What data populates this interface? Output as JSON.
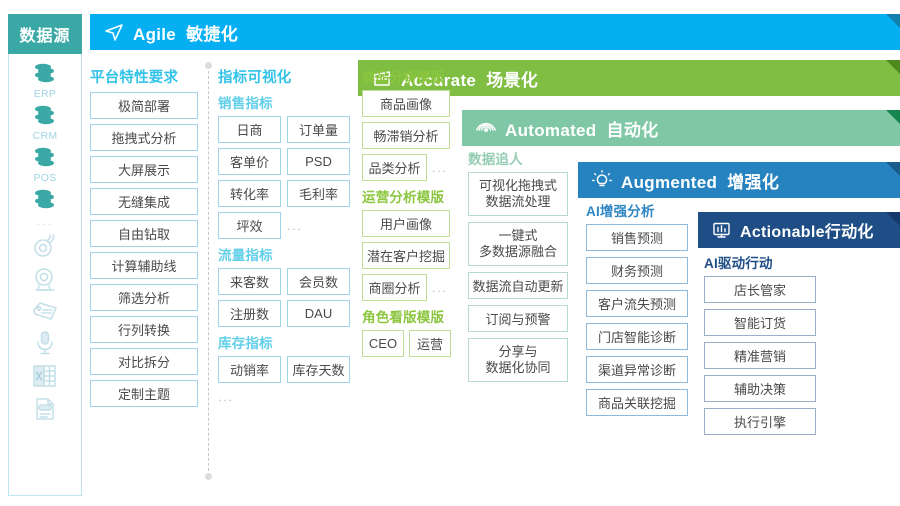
{
  "colors": {
    "agile": "#06aff2",
    "accurate": "#7fbe42",
    "automated": "#80c7a6",
    "augmented": "#2783c0",
    "actionable": "#1f4e87",
    "datasource": "#3aa9a6"
  },
  "datasource": {
    "title": "数据源",
    "items": [
      {
        "icon": "database-icon",
        "label": "ERP"
      },
      {
        "icon": "database-icon",
        "label": "CRM"
      },
      {
        "icon": "database-icon",
        "label": "POS"
      },
      {
        "icon": "database-icon",
        "label": ""
      },
      {
        "icon": "ellipsis",
        "label": "..."
      },
      {
        "icon": "sensor-icon",
        "label": ""
      },
      {
        "icon": "camera-icon",
        "label": ""
      },
      {
        "icon": "rfid-tag-icon",
        "label": ""
      },
      {
        "icon": "microphone-icon",
        "label": ""
      },
      {
        "icon": "excel-file-icon",
        "label": ""
      },
      {
        "icon": "pdf-file-icon",
        "label": ""
      }
    ]
  },
  "banners": {
    "agile": {
      "en": "Agile",
      "cn": "敏捷化",
      "icon": "paper-plane-icon"
    },
    "accurate": {
      "en": "Accurate",
      "cn": "场景化",
      "icon": "clapperboard-icon"
    },
    "automated": {
      "en": "Automated",
      "cn": "自动化",
      "icon": "signal-waves-icon"
    },
    "augmented": {
      "en": "Augmented",
      "cn": "增强化",
      "icon": "lightbulb-icon"
    },
    "actionable": {
      "en": "Actionable",
      "cn": "行动化",
      "icon": "dashboard-chart-icon"
    }
  },
  "platform": {
    "title": "平台特性要求",
    "items": [
      "极简部署",
      "拖拽式分析",
      "大屏展示",
      "无缝集成",
      "自由钻取",
      "计算辅助线",
      "筛选分析",
      "行列转换",
      "对比拆分",
      "定制主题"
    ]
  },
  "metrics": {
    "title": "指标可视化",
    "groups": [
      {
        "title": "销售指标",
        "rows": [
          [
            "日商",
            "订单量"
          ],
          [
            "客单价",
            "PSD"
          ],
          [
            "转化率",
            "毛利率"
          ],
          [
            "坪效",
            "..."
          ]
        ]
      },
      {
        "title": "流量指标",
        "rows": [
          [
            "来客数",
            "会员数"
          ],
          [
            "注册数",
            "DAU"
          ]
        ]
      },
      {
        "title": "库存指标",
        "rows": [
          [
            "动销率",
            "库存天数"
          ]
        ],
        "trailing_dots": "..."
      }
    ]
  },
  "templates": {
    "groups": [
      {
        "title": "商品分析模版",
        "items": [
          "商品画像",
          "畅滞销分析"
        ],
        "last_row": {
          "item": "品类分析",
          "dots": "..."
        }
      },
      {
        "title": "运营分析模版",
        "items": [
          "用户画像",
          "潜在客户挖掘"
        ],
        "last_row": {
          "item": "商圈分析",
          "dots": "..."
        }
      },
      {
        "title": "角色看版模版",
        "pair": [
          "CEO",
          "运营"
        ]
      }
    ]
  },
  "automated": {
    "title": "数据追人",
    "items": [
      {
        "lines": [
          "可视化拖拽式",
          "数据流处理"
        ]
      },
      {
        "lines": [
          "一键式",
          "多数据源融合"
        ]
      },
      {
        "lines": [
          "数据流自动更新"
        ]
      },
      {
        "lines": [
          "订阅与预警"
        ]
      },
      {
        "lines": [
          "分享与",
          "数据化协同"
        ]
      }
    ]
  },
  "augmented": {
    "title": "AI增强分析",
    "items": [
      "销售预测",
      "财务预测",
      "客户流失预测",
      "门店智能诊断",
      "渠道异常诊断",
      "商品关联挖掘"
    ]
  },
  "actionable": {
    "title": "AI驱动行动",
    "items": [
      "店长管家",
      "智能订货",
      "精准营销",
      "辅助决策",
      "执行引擎"
    ]
  }
}
